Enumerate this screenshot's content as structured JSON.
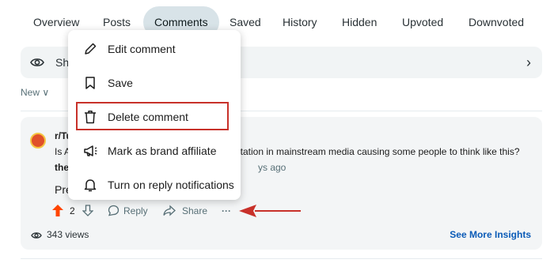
{
  "tabs": [
    {
      "label": "Overview",
      "active": false
    },
    {
      "label": "Posts",
      "active": false
    },
    {
      "label": "Comments",
      "active": true
    },
    {
      "label": "Saved",
      "active": false
    },
    {
      "label": "History",
      "active": false
    },
    {
      "label": "Hidden",
      "active": false
    },
    {
      "label": "Upvoted",
      "active": false
    },
    {
      "label": "Downvoted",
      "active": false
    }
  ],
  "show_bar": {
    "text": "Sho",
    "icon": "eye-icon",
    "chevron": "›"
  },
  "sort": {
    "label": "New ∨"
  },
  "comment": {
    "subreddit": "r/Tu",
    "post_title_start": "Is A",
    "post_title_end": "ntation in mainstream media causing some people to think like this?",
    "user": "the",
    "time": "ys ago",
    "body": "Pre",
    "votes": "2",
    "reply_label": "Reply",
    "share_label": "Share",
    "more_label": "···",
    "views": "343 views",
    "insights_label": "See More Insights"
  },
  "menu": {
    "items": [
      {
        "label": "Edit comment",
        "icon": "pencil-icon"
      },
      {
        "label": "Save",
        "icon": "bookmark-icon"
      },
      {
        "label": "Delete comment",
        "icon": "trash-icon",
        "highlighted": true
      },
      {
        "label": "Mark as brand affiliate",
        "icon": "megaphone-icon"
      },
      {
        "label": "Turn on reply notifications",
        "icon": "bell-icon"
      }
    ]
  },
  "colors": {
    "tab_active_bg": "#d8e3e8",
    "card_bg": "#f3f5f6",
    "upvote": "#ff4500",
    "highlight_border": "#c8312a",
    "link": "#0a5bb7"
  }
}
